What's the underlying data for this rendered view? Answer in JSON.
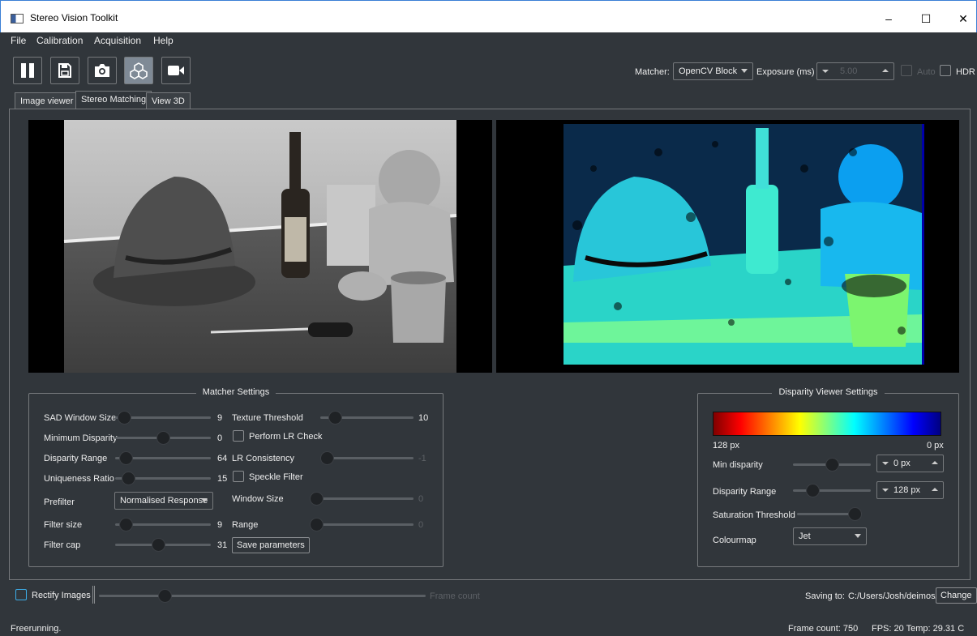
{
  "window": {
    "title": "Stereo Vision Toolkit",
    "minimize": "–",
    "maximize": "☐",
    "close": "✕"
  },
  "menu": [
    "File",
    "Calibration",
    "Acquisition",
    "Help"
  ],
  "toolbar": {
    "icons": [
      "pause-icon",
      "save-icon",
      "camera-icon",
      "stereo-icon",
      "video-icon"
    ],
    "matcher_label": "Matcher:",
    "matcher_value": "OpenCV Block",
    "exposure_label": "Exposure (ms)",
    "exposure_value": "5.00",
    "auto_label": "Auto",
    "hdr_label": "HDR"
  },
  "tabs": [
    "Image viewer",
    "Stereo Matching",
    "View 3D"
  ],
  "selected_tab": "Stereo Matching",
  "matcher_settings": {
    "title": "Matcher Settings",
    "sad_window_label": "SAD Window  Size",
    "sad_window_value": "9",
    "min_disparity_label": "Minimum Disparity",
    "min_disparity_value": "0",
    "disparity_range_label": "Disparity Range",
    "disparity_range_value": "64",
    "uniqueness_label": "Uniqueness Ratio",
    "uniqueness_value": "15",
    "prefilter_label": "Prefilter",
    "prefilter_value": "Normalised Response",
    "filter_size_label": "Filter size",
    "filter_size_value": "9",
    "filter_cap_label": "Filter cap",
    "filter_cap_value": "31",
    "texture_threshold_label": "Texture Threshold",
    "texture_threshold_value": "10",
    "perform_lr_label": "Perform LR Check",
    "lr_consistency_label": "LR Consistency",
    "lr_consistency_value": "-1",
    "speckle_label": "Speckle Filter",
    "window_size_label": "Window Size",
    "window_size_value": "0",
    "range_label": "Range",
    "range_value": "0",
    "save_button": "Save parameters"
  },
  "disparity_settings": {
    "title": "Disparity Viewer Settings",
    "left_scale": "128 px",
    "right_scale": "0 px",
    "min_disparity_label": "Min disparity",
    "min_disparity_value": "0 px",
    "disparity_range_label": "Disparity Range",
    "disparity_range_value": "128 px",
    "saturation_label": "Saturation Threshold",
    "colourmap_label": "Colourmap",
    "colourmap_value": "Jet"
  },
  "bottom": {
    "rectify_label": "Rectify Images",
    "frame_count_placeholder": "Frame count",
    "saving_to_label": "Saving to:",
    "saving_path": "C:/Users/Josh/deimos/",
    "change_button": "Change"
  },
  "status": {
    "message": "Freerunning.",
    "frame_count": "Frame count: 750",
    "fps_temp": "FPS: 20  Temp: 29.31 C"
  },
  "slider_levels": {
    "sad_window": 0.03,
    "min_disparity": 0.5,
    "disparity_range": 0.05,
    "uniqueness": 0.08,
    "filter_size": 0.05,
    "filter_cap": 0.45,
    "texture_threshold": 0.1,
    "lr_consistency": 0.0,
    "window_size": 0.0,
    "range": 0.0,
    "viewer_min_disparity": 0.5,
    "viewer_disparity_range": 0.2,
    "saturation": 1.0,
    "frame_position": 0.19
  }
}
